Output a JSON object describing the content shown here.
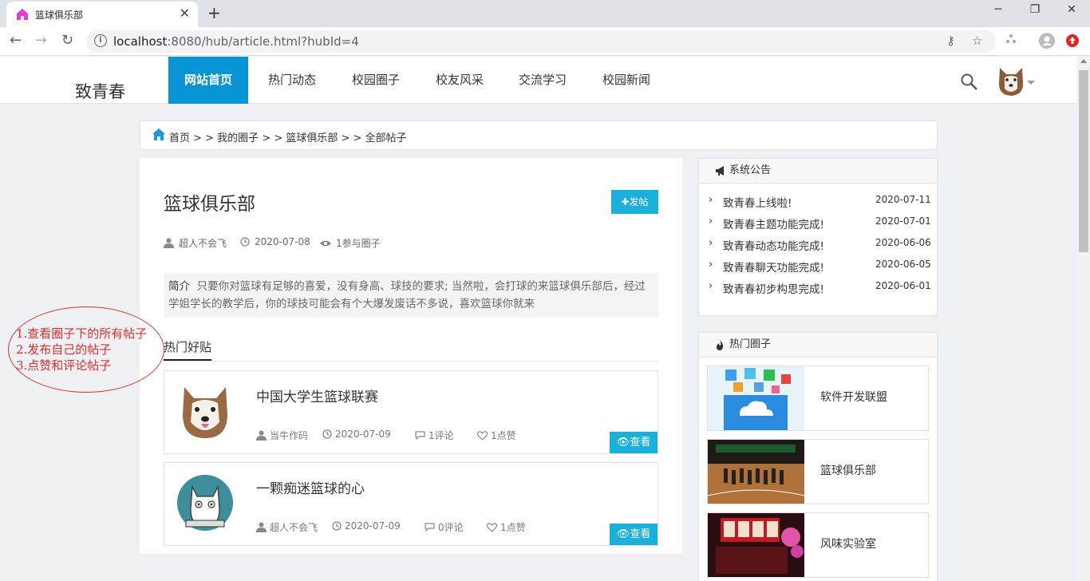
{
  "browser": {
    "tab_title": "篮球俱乐部",
    "url_host": "localhost",
    "url_rest": ":8080/hub/article.html?hubId=4"
  },
  "site": {
    "logo": "致青春",
    "nav": [
      "网站首页",
      "热门动态",
      "校园圈子",
      "校友风采",
      "交流学习",
      "校园新闻"
    ],
    "accent_color": "#0994d6",
    "button_color": "#1ab0d9"
  },
  "breadcrumb": "首页 > > 我的圈子 > > 篮球俱乐部 > > 全部帖子",
  "club": {
    "title": "篮球俱乐部",
    "post_button": "发帖",
    "author": "超人不会飞",
    "date": "2020-07-08",
    "members": "1参与圈子",
    "intro_label": "简介",
    "intro_text": "只要你对篮球有足够的喜爱，没有身高、球技的要求; 当然啦，会打球的来篮球俱乐部后，经过学姐学长的教学后，你的球技可能会有个大爆发废话不多说，喜欢篮球你就来"
  },
  "hot_posts": {
    "tab_label": "热门好贴",
    "view_label": "查看",
    "items": [
      {
        "title": "中国大学生篮球联赛",
        "author": "当牛作码",
        "date": "2020-07-09",
        "comments": "1评论",
        "likes": "1点赞"
      },
      {
        "title": "一颗痴迷篮球的心",
        "author": "超人不会飞",
        "date": "2020-07-09",
        "comments": "0评论",
        "likes": "1点赞"
      }
    ]
  },
  "notices": {
    "title": "系统公告",
    "items": [
      {
        "text": "致青春上线啦!",
        "date": "2020-07-11"
      },
      {
        "text": "致青春主题功能完成!",
        "date": "2020-07-01"
      },
      {
        "text": "致青春动态功能完成!",
        "date": "2020-06-06"
      },
      {
        "text": "致青春聊天功能完成!",
        "date": "2020-06-05"
      },
      {
        "text": "致青春初步构思完成!",
        "date": "2020-06-01"
      }
    ]
  },
  "hot_clubs": {
    "title": "热门圈子",
    "items": [
      "软件开发联盟",
      "篮球俱乐部",
      "风味实验室"
    ]
  },
  "annotation": {
    "lines": [
      "1.查看圈子下的所有帖子",
      "2.发布自己的帖子",
      "3.点赞和评论帖子"
    ],
    "color": "#d9302c"
  }
}
